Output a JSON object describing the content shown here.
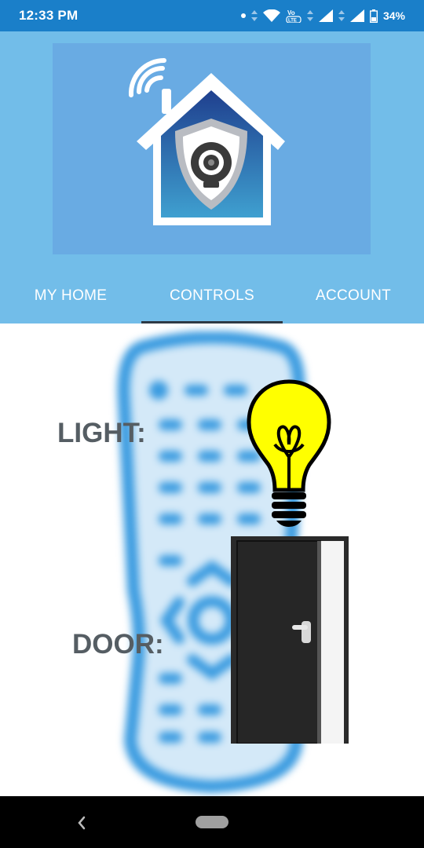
{
  "status_bar": {
    "time": "12:33 PM",
    "battery": "34%",
    "icons": [
      "notification-dot-icon",
      "data-arrows-icon",
      "wifi-icon",
      "volte-icon",
      "signal-icon",
      "battery-icon"
    ],
    "volte_label": "Vo LTE"
  },
  "header": {
    "logo": "home-security-camera-logo",
    "colors": {
      "background": "#72bde9",
      "logo_background": "#69abe3"
    }
  },
  "tabs": {
    "items": [
      {
        "label": "MY HOME"
      },
      {
        "label": "CONTROLS",
        "active": true
      },
      {
        "label": "ACCOUNT"
      }
    ]
  },
  "controls": {
    "light_label": "LIGHT:",
    "door_label": "DOOR:",
    "light_icon": "light-bulb-icon",
    "door_icon": "door-icon",
    "background_image": "remote-control-illustration"
  },
  "nav_bar": {
    "icons": [
      "back-icon",
      "home-pill-icon"
    ]
  },
  "colors": {
    "status_bar": "#1a7fc9",
    "tab_indicator": "#2e3a45",
    "label_text": "#555d63",
    "bulb_yellow": "#ffff00"
  }
}
